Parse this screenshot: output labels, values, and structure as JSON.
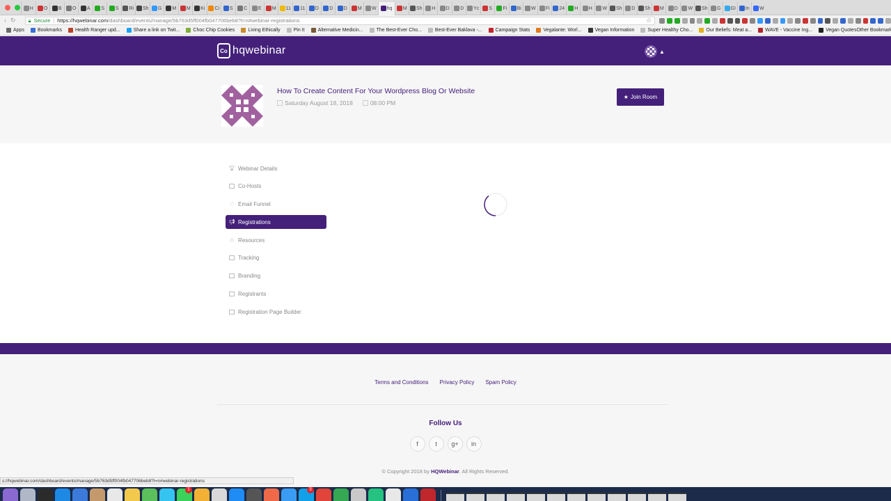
{
  "browser": {
    "tabs": [
      "H",
      "O",
      "B",
      "O",
      "A",
      "S",
      "S",
      "Ri",
      "Sh",
      "G",
      "M",
      "M",
      "Ki",
      "Ci",
      "S",
      "C",
      "E",
      "M",
      "11",
      "11",
      "D",
      "D",
      "D",
      "M",
      "W",
      "hq",
      "M",
      "Sh",
      "H",
      "D",
      "D",
      "Yc",
      "S",
      "Fi",
      "Bi",
      "W",
      "Fi",
      "24",
      "H",
      "H",
      "W",
      "Sh",
      "D",
      "Sh",
      "M",
      "D",
      "W",
      "Sh",
      "G",
      "GI",
      "In",
      "W"
    ],
    "active_tab": "hq",
    "secure_label": "Secure",
    "url_host": "https://hqwebinar.com",
    "url_path": "/dashboard/events/manage/5b763d5ff004fb047706beb8?t=n#webinar-registrations",
    "status_url": "s://hqwebinar.com/dashboard/events/manage/5b763d5ff004fb047706beb8?t=n#webinar-registrations"
  },
  "bookmarks": [
    {
      "label": "Apps",
      "color": "#6a6a6a"
    },
    {
      "label": "Bookmarks",
      "color": "#3a6fd8"
    },
    {
      "label": "Health Ranger upd...",
      "color": "#b5432b"
    },
    {
      "label": "Share a link on Twit...",
      "color": "#1da1f2"
    },
    {
      "label": "Choc Chip Cookies",
      "color": "#7fae3a"
    },
    {
      "label": "Living Ethically",
      "color": "#c98b2a"
    },
    {
      "label": "Pin It",
      "color": "#bdbdbd"
    },
    {
      "label": "Alternative Medicin...",
      "color": "#7a5a3a"
    },
    {
      "label": "The Best-Ever Cho...",
      "color": "#bdbdbd"
    },
    {
      "label": "Best-Ever Baklava -...",
      "color": "#bdbdbd"
    },
    {
      "label": "Campaign Stats",
      "color": "#c0272d"
    },
    {
      "label": "Vegalante: Worl...",
      "color": "#e07b20"
    },
    {
      "label": "Vegan Information",
      "color": "#333333"
    },
    {
      "label": "Super Healthy Cho...",
      "color": "#bdbdbd"
    },
    {
      "label": "Our Beliefs: Meat a...",
      "color": "#e0b020"
    },
    {
      "label": "WAVE - Vaccine Ing...",
      "color": "#b0272d"
    },
    {
      "label": "Vegan Quotes",
      "color": "#222222"
    }
  ],
  "bookmarks_other": "Other Bookmarks",
  "header": {
    "logo_mark": "Co",
    "logo_text": "hqwebinar"
  },
  "event": {
    "title": "How To Create Content For Your Wordpress Blog Or Website",
    "date": "Saturday August 18, 2018",
    "time": "08:00 PM",
    "join_label": "Join Room"
  },
  "sidenav": {
    "items": [
      {
        "label": "Webinar Details",
        "icon": "trophy-icon"
      },
      {
        "label": "Co-Hosts",
        "icon": "book-icon"
      },
      {
        "label": "Email Funnel",
        "icon": "heart-icon"
      },
      {
        "label": "Registrations",
        "icon": "megaphone-icon"
      },
      {
        "label": "Resources",
        "icon": "diamond-icon"
      },
      {
        "label": "Tracking",
        "icon": "book-icon"
      },
      {
        "label": "Branding",
        "icon": "book-icon"
      },
      {
        "label": "Registrants",
        "icon": "book-icon"
      },
      {
        "label": "Registration Page Builder",
        "icon": "book-icon"
      }
    ],
    "active": "Registrations"
  },
  "footer": {
    "links": [
      "Terms and Conditions",
      "Privacy Policy",
      "Spam Policy"
    ],
    "follow_title": "Follow Us",
    "socials": [
      {
        "name": "facebook-icon",
        "glyph": "f"
      },
      {
        "name": "twitter-icon",
        "glyph": "t"
      },
      {
        "name": "google-plus-icon",
        "glyph": "g+"
      },
      {
        "name": "linkedin-icon",
        "glyph": "in"
      }
    ],
    "copyright_prefix": "© Copyright 2018 by ",
    "copyright_brand": "HQWebinar",
    "copyright_suffix": ". All Rights Reserved."
  },
  "dock": {
    "badges": {
      "messages": "1",
      "skype": "3"
    }
  },
  "colors": {
    "brand_purple": "#44207a"
  }
}
